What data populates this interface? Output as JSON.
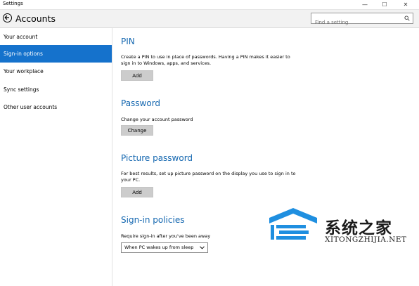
{
  "window": {
    "title": "Settings",
    "min_glyph": "—",
    "max_glyph": "☐",
    "close_glyph": "✕"
  },
  "header": {
    "title": "Accounts",
    "search": {
      "placeholder": "Find a setting",
      "value": ""
    }
  },
  "sidebar": {
    "items": [
      {
        "label": "Your account",
        "active": false
      },
      {
        "label": "Sign-in options",
        "active": true
      },
      {
        "label": "Your workplace",
        "active": false
      },
      {
        "label": "Sync settings",
        "active": false
      },
      {
        "label": "Other user accounts",
        "active": false
      }
    ]
  },
  "pin": {
    "title": "PIN",
    "description": "Create a PIN to use in place of passwords. Having a PIN makes it easier to sign in to Windows, apps, and services.",
    "button": "Add"
  },
  "password": {
    "title": "Password",
    "description": "Change your account password",
    "button": "Change"
  },
  "picture_password": {
    "title": "Picture password",
    "description": "For best results, set up picture password on the display you use to sign in to your PC.",
    "button": "Add"
  },
  "policies": {
    "title": "Sign-in policies",
    "description": "Require sign-in after you've been away",
    "selected": "When PC wakes up from sleep"
  },
  "watermark": {
    "text": "系统之家",
    "url": "XITONGZHIJIA.NET"
  },
  "colors": {
    "accent": "#1572cc",
    "heading": "#1467b0",
    "button": "#cccccc"
  }
}
